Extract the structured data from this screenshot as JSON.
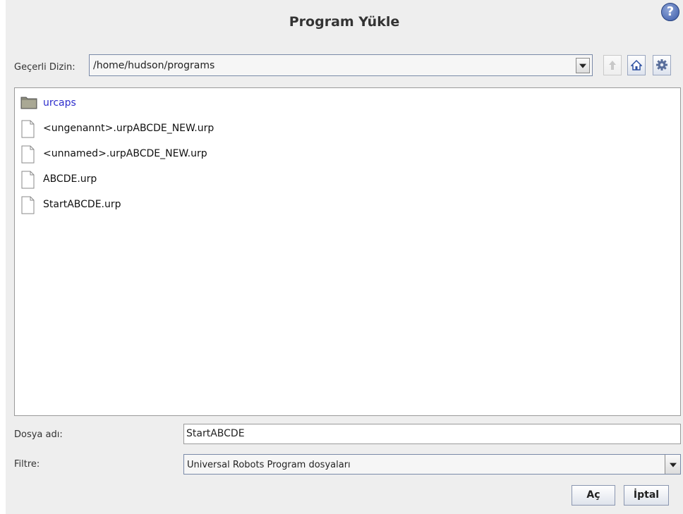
{
  "dialog": {
    "title": "Program Yükle",
    "help_icon": "question-circle-icon"
  },
  "directory": {
    "label": "Geçerli Dizin:",
    "value": "/home/hudson/programs"
  },
  "toolbar": {
    "up_icon": "arrow-up-icon",
    "home_icon": "home-icon",
    "settings_icon": "gear-icon"
  },
  "files": [
    {
      "name": "urcaps",
      "type": "folder"
    },
    {
      "name": "<ungenannt>.urpABCDE_NEW.urp",
      "type": "file"
    },
    {
      "name": "<unnamed>.urpABCDE_NEW.urp",
      "type": "file"
    },
    {
      "name": "ABCDE.urp",
      "type": "file"
    },
    {
      "name": "StartABCDE.urp",
      "type": "file"
    }
  ],
  "filename": {
    "label": "Dosya adı:",
    "value": "StartABCDE"
  },
  "filter": {
    "label": "Filtre:",
    "value": "Universal Robots Program dosyaları"
  },
  "buttons": {
    "open": "Aç",
    "cancel": "İptal"
  },
  "colors": {
    "folder_name": "#2d2dcc",
    "dialog_bg": "#eeeeee"
  }
}
